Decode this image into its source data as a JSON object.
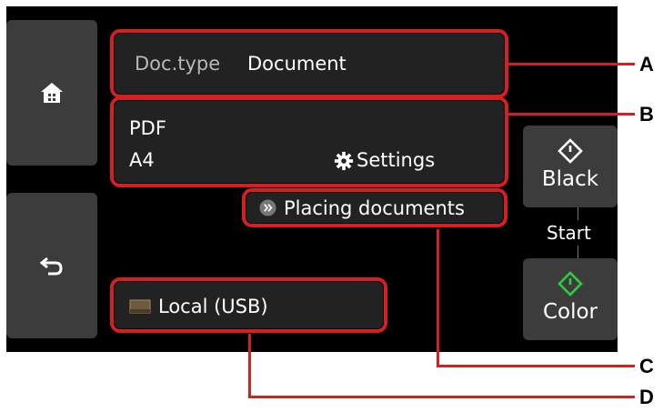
{
  "doc_type": {
    "label": "Doc.type",
    "value": "Document"
  },
  "scan_settings": {
    "format": "PDF",
    "paper_size": "A4",
    "settings_label": "Settings",
    "settings_icon": "gear-icon"
  },
  "placing_documents": {
    "label": "Placing documents",
    "icon": "double-chevron-right-icon"
  },
  "save_location": {
    "label": "Local (USB)",
    "icon": "usb-drive-icon"
  },
  "start": {
    "black_label": "Black",
    "start_label": "Start",
    "color_label": "Color",
    "black_icon_color": "#ffffff",
    "color_icon_color": "#2ecc40"
  },
  "nav": {
    "home_icon": "home-icon",
    "back_icon": "back-icon"
  },
  "callouts": {
    "a": "A",
    "b": "B",
    "c": "C",
    "d": "D"
  },
  "colors": {
    "highlight": "#d32020",
    "background": "#000000",
    "field": "#222222",
    "button": "#3c3c3c"
  }
}
